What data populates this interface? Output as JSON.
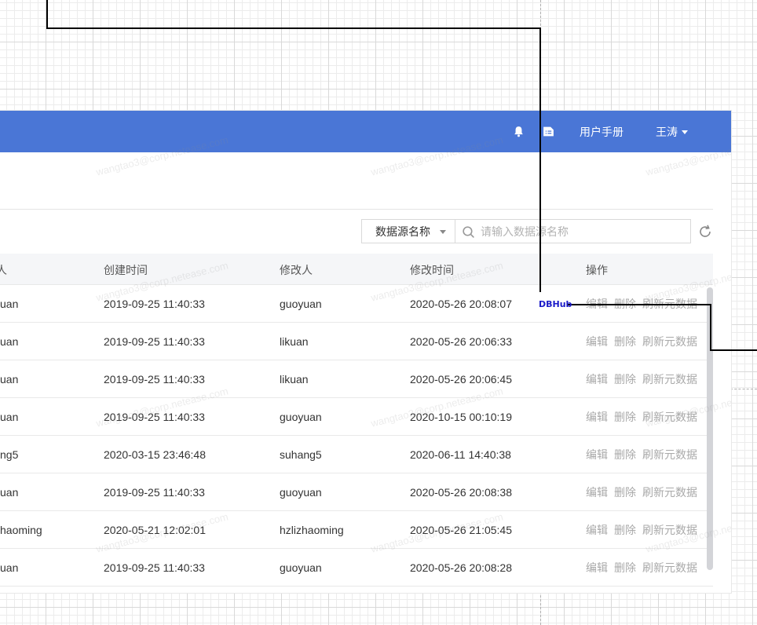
{
  "header": {
    "user_manual": "用户手册",
    "user_name": "王涛",
    "bell_icon": "bell-icon",
    "doc_icon": "document-icon",
    "background": "#4a76d6"
  },
  "watermark": "wangtao3@corp.netease.com",
  "filter": {
    "select_value": "数据源名称",
    "search_placeholder": "请输入数据源名称",
    "refresh_icon": "refresh-icon"
  },
  "table": {
    "columns": [
      "人",
      "创建时间",
      "修改人",
      "修改时间",
      "操作"
    ],
    "rows": [
      {
        "creator": "uan",
        "created": "2019-09-25 11:40:33",
        "modifier": "guoyuan",
        "modified": "2020-05-26 20:08:07"
      },
      {
        "creator": "uan",
        "created": "2019-09-25 11:40:33",
        "modifier": "likuan",
        "modified": "2020-05-26 20:06:33"
      },
      {
        "creator": "uan",
        "created": "2019-09-25 11:40:33",
        "modifier": "likuan",
        "modified": "2020-05-26 20:06:45"
      },
      {
        "creator": "uan",
        "created": "2019-09-25 11:40:33",
        "modifier": "guoyuan",
        "modified": "2020-10-15 00:10:19"
      },
      {
        "creator": "ng5",
        "created": "2020-03-15 23:46:48",
        "modifier": "suhang5",
        "modified": "2020-06-11 14:40:38"
      },
      {
        "creator": "uan",
        "created": "2019-09-25 11:40:33",
        "modifier": "guoyuan",
        "modified": "2020-05-26 20:08:38"
      },
      {
        "creator": "haoming",
        "created": "2020-05-21 12:02:01",
        "modifier": "hzlizhaoming",
        "modified": "2020-05-26 21:05:45"
      },
      {
        "creator": "uan",
        "created": "2019-09-25 11:40:33",
        "modifier": "guoyuan",
        "modified": "2020-05-26 20:08:28"
      }
    ],
    "actions": {
      "edit": "编辑",
      "delete": "删除",
      "refresh_meta": "刷新元数据"
    }
  },
  "annotation": {
    "label": "DBHub",
    "color": "#1a1ac8"
  }
}
